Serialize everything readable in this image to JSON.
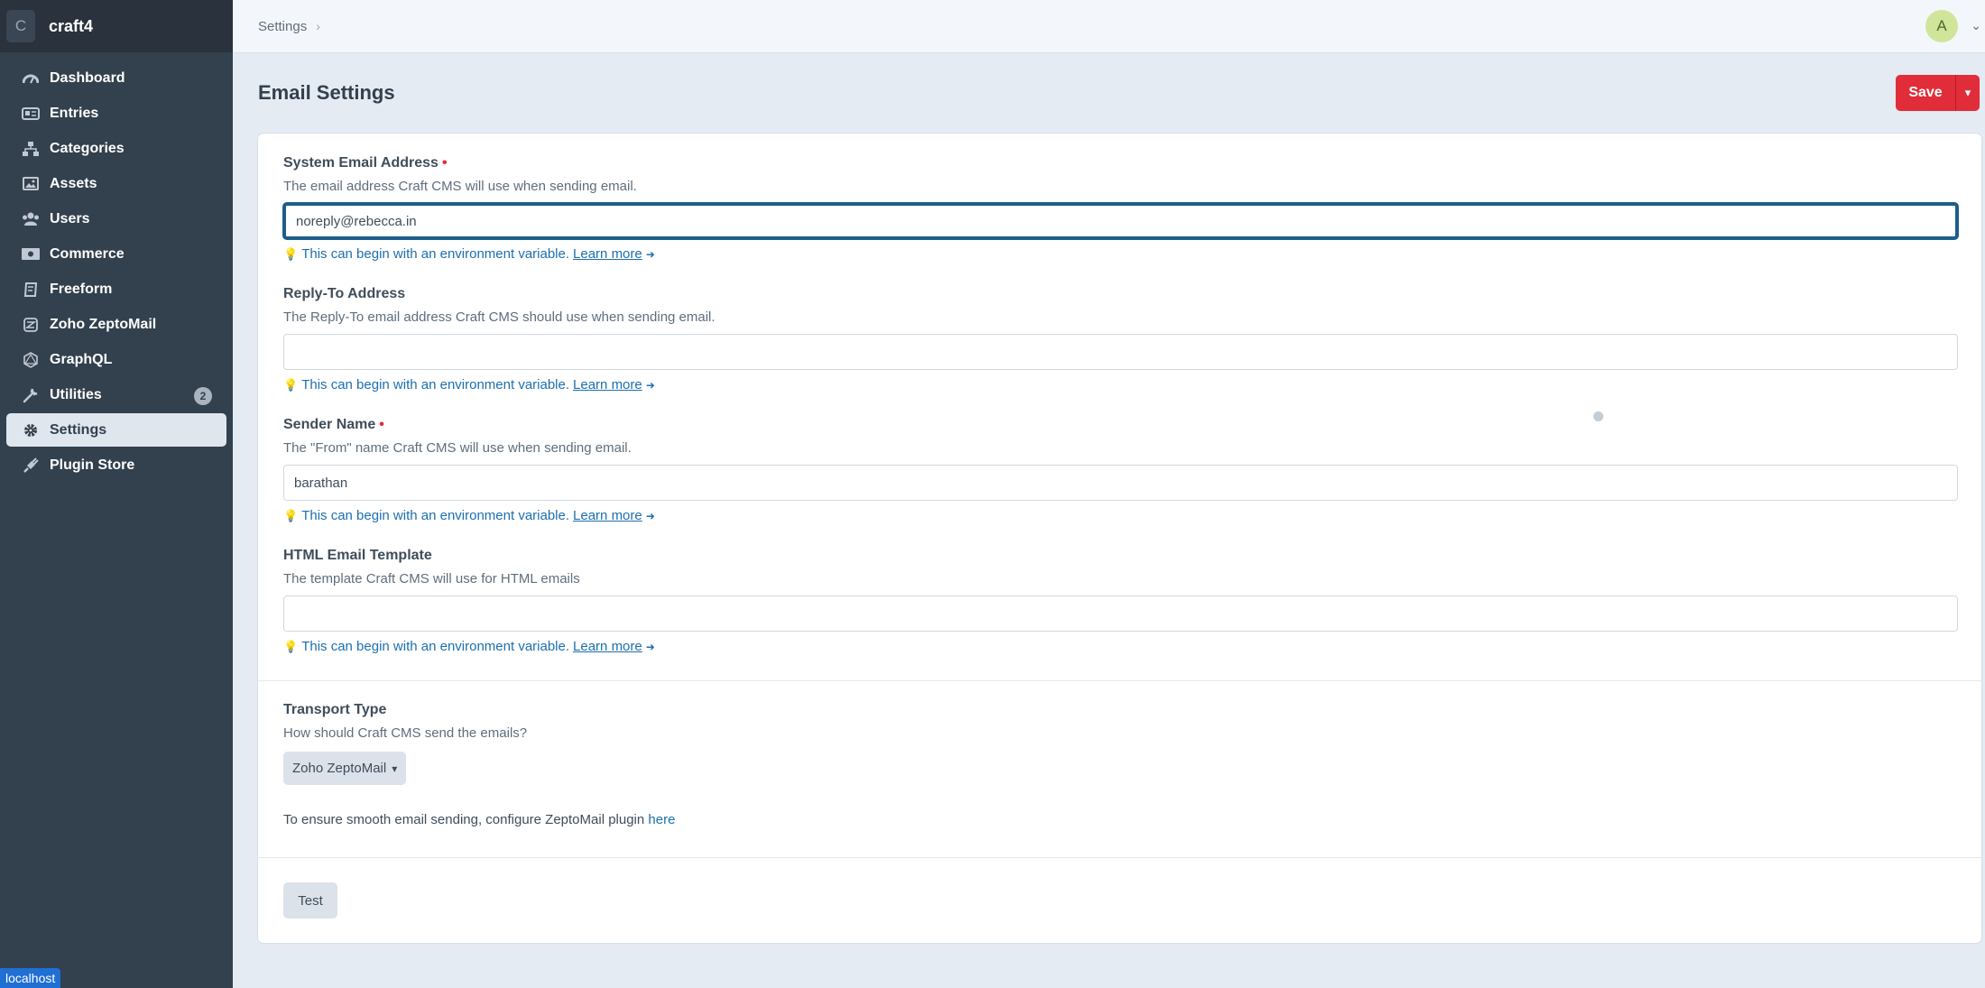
{
  "site": {
    "logo_letter": "C",
    "name": "craft4"
  },
  "sidebar": {
    "items": [
      {
        "label": "Dashboard",
        "icon": "gauge-icon"
      },
      {
        "label": "Entries",
        "icon": "newspaper-icon"
      },
      {
        "label": "Categories",
        "icon": "sitemap-icon"
      },
      {
        "label": "Assets",
        "icon": "image-icon"
      },
      {
        "label": "Users",
        "icon": "users-icon"
      },
      {
        "label": "Commerce",
        "icon": "money-icon"
      },
      {
        "label": "Freeform",
        "icon": "freeform-icon"
      },
      {
        "label": "Zoho ZeptoMail",
        "icon": "zeptomail-icon"
      },
      {
        "label": "GraphQL",
        "icon": "graphql-icon"
      },
      {
        "label": "Utilities",
        "icon": "wrench-icon",
        "badge": "2"
      },
      {
        "label": "Settings",
        "icon": "gear-icon",
        "active": true
      },
      {
        "label": "Plugin Store",
        "icon": "plug-icon"
      }
    ],
    "environment": "localhost"
  },
  "topbar": {
    "breadcrumb": "Settings",
    "avatar_letter": "A"
  },
  "page": {
    "title": "Email Settings",
    "save_label": "Save"
  },
  "fields": {
    "tip_text": "This can begin with an environment variable.",
    "learn_more": "Learn more",
    "system_email": {
      "label": "System Email Address",
      "instructions": "The email address Craft CMS will use when sending email.",
      "value": "noreply@rebecca.in"
    },
    "reply_to": {
      "label": "Reply-To Address",
      "instructions": "The Reply-To email address Craft CMS should use when sending email.",
      "value": ""
    },
    "sender_name": {
      "label": "Sender Name",
      "instructions": "The \"From\" name Craft CMS will use when sending email.",
      "value": "barathan"
    },
    "html_template": {
      "label": "HTML Email Template",
      "instructions": "The template Craft CMS will use for HTML emails",
      "value": ""
    },
    "transport": {
      "label": "Transport Type",
      "instructions": "How should Craft CMS send the emails?",
      "selected": "Zoho ZeptoMail"
    },
    "note_text": "To ensure smooth email sending, configure ZeptoMail plugin",
    "note_link": "here",
    "test_label": "Test"
  },
  "colors": {
    "accent": "#e12d39",
    "sidebar": "#33404d",
    "link": "#1c6fb0",
    "focus": "#1c5e8c"
  }
}
